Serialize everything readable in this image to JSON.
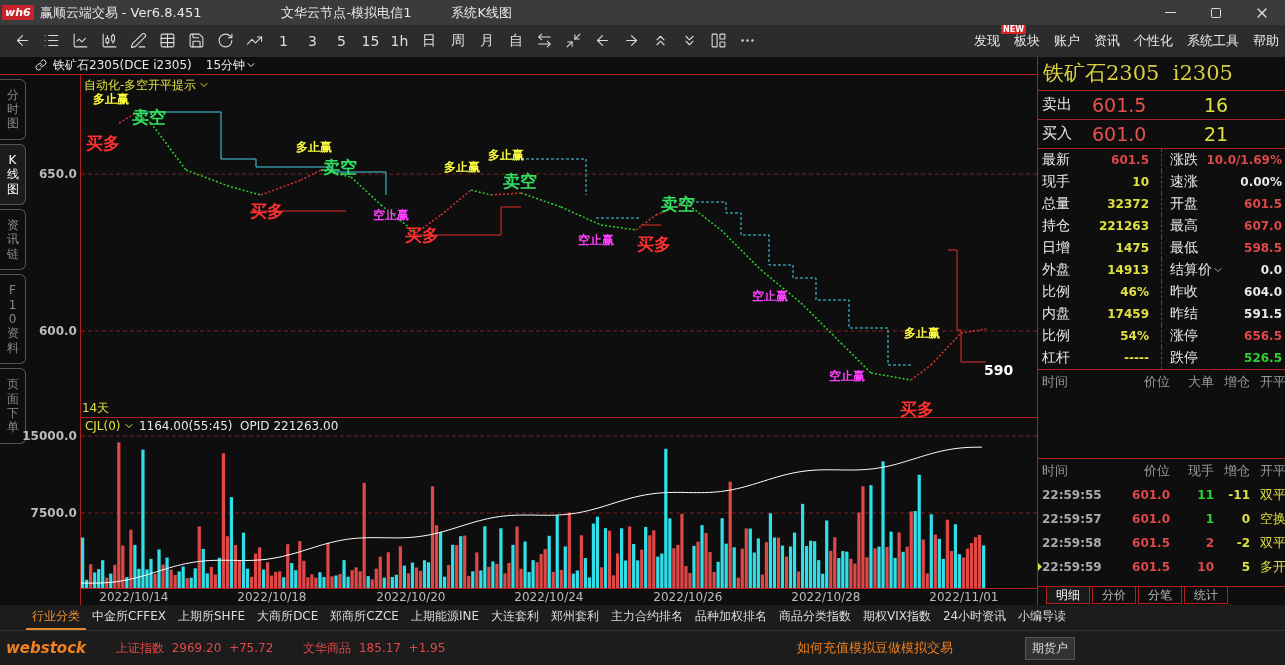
{
  "window": {
    "logo": "wh6",
    "title": "赢顺云端交易 - Ver6.8.451",
    "node": "文华云节点-模拟电信1",
    "view": "系统K线图"
  },
  "toolbar": {
    "periods": [
      "1",
      "3",
      "5",
      "15",
      "1h",
      "日",
      "周",
      "月",
      "自"
    ],
    "menu": [
      {
        "label": "发现",
        "badge": "NEW"
      },
      {
        "label": "板块"
      },
      {
        "label": "账户"
      },
      {
        "label": "资讯"
      },
      {
        "label": "个性化"
      },
      {
        "label": "系统工具"
      },
      {
        "label": "帮助"
      }
    ]
  },
  "chart_header": {
    "symbol": "铁矿石2305(DCE i2305)",
    "period": "15分钟"
  },
  "side_tabs": [
    {
      "label": "分时图",
      "selected": false
    },
    {
      "label": "K线图",
      "selected": true
    },
    {
      "label": "资讯链",
      "selected": false
    },
    {
      "label": "F10资料",
      "selected": false
    },
    {
      "label": "页面下单",
      "selected": false
    }
  ],
  "price_panel": {
    "indicator": "自动化-多空开平提示",
    "yticks": [
      "650.0",
      "600.0"
    ],
    "days": "14天",
    "last_label": "590",
    "signals": [
      {
        "text": "多止赢",
        "kind": "exit-long"
      },
      {
        "text": "卖空",
        "kind": "sell"
      },
      {
        "text": "买多",
        "kind": "buy"
      },
      {
        "text": "多止赢",
        "kind": "exit-long"
      },
      {
        "text": "卖空",
        "kind": "sell"
      },
      {
        "text": "买多",
        "kind": "buy"
      },
      {
        "text": "空止赢",
        "kind": "exit-short"
      },
      {
        "text": "买多",
        "kind": "buy"
      },
      {
        "text": "多止赢",
        "kind": "exit-long"
      },
      {
        "text": "多止赢",
        "kind": "exit-long"
      },
      {
        "text": "卖空",
        "kind": "sell"
      },
      {
        "text": "空止赢",
        "kind": "exit-short"
      },
      {
        "text": "买多",
        "kind": "buy"
      },
      {
        "text": "卖空",
        "kind": "sell"
      },
      {
        "text": "空止赢",
        "kind": "exit-short"
      },
      {
        "text": "空止赢",
        "kind": "exit-short"
      },
      {
        "text": "多止赢",
        "kind": "exit-long"
      },
      {
        "text": "买多",
        "kind": "buy"
      }
    ]
  },
  "volume_panel": {
    "indicator": "CJL(0)",
    "reading": "1164.00(55:45)  OPID 221263.00",
    "yticks": [
      "15000.0",
      "7500.0"
    ]
  },
  "dates": [
    "2022/10/14",
    "2022/10/18",
    "2022/10/20",
    "2022/10/24",
    "2022/10/26",
    "2022/10/28",
    "2022/11/01"
  ],
  "quote": {
    "title": "铁矿石2305  i2305",
    "book": [
      {
        "label": "卖出",
        "price": "601.5",
        "qty": "16"
      },
      {
        "label": "买入",
        "price": "601.0",
        "qty": "21"
      }
    ],
    "stats": [
      {
        "label": "最新",
        "value": "601.5",
        "color": "#e04848"
      },
      {
        "label": "涨跌",
        "value": "10.0/1.69%",
        "color": "#e04848"
      },
      {
        "label": "现手",
        "value": "10",
        "color": "#e0e040"
      },
      {
        "label": "速涨",
        "value": "0.00%",
        "color": "#e8e8e8"
      },
      {
        "label": "总量",
        "value": "32372",
        "color": "#e0e040"
      },
      {
        "label": "开盘",
        "value": "601.5",
        "color": "#e04848"
      },
      {
        "label": "持仓",
        "value": "221263",
        "color": "#e0e040"
      },
      {
        "label": "最高",
        "value": "607.0",
        "color": "#e04848"
      },
      {
        "label": "日增",
        "value": "1475",
        "color": "#e0e040"
      },
      {
        "label": "最低",
        "value": "598.5",
        "color": "#e04848"
      },
      {
        "label": "外盘",
        "value": "14913",
        "color": "#e0e040"
      },
      {
        "label": "结算价",
        "value": "0.0",
        "color": "#e8e8e8",
        "dropdown": true
      },
      {
        "label": "比例",
        "value": "46%",
        "color": "#e0e040"
      },
      {
        "label": "昨收",
        "value": "604.0",
        "color": "#e8e8e8"
      },
      {
        "label": "内盘",
        "value": "17459",
        "color": "#e0e040"
      },
      {
        "label": "昨结",
        "value": "591.5",
        "color": "#e8e8e8"
      },
      {
        "label": "比例",
        "value": "54%",
        "color": "#e0e040"
      },
      {
        "label": "涨停",
        "value": "656.5",
        "color": "#e04848"
      },
      {
        "label": "杠杆",
        "value": "-----",
        "color": "#e0e040"
      },
      {
        "label": "跌停",
        "value": "526.5",
        "color": "#30d030"
      }
    ],
    "big_orders_columns": [
      "时间",
      "价位",
      "大单",
      "增仓",
      "开平"
    ],
    "ticks_columns": [
      "时间",
      "价位",
      "现手",
      "增仓",
      "开平"
    ],
    "ticks": [
      {
        "time": "22:59:55",
        "price": "601.0",
        "qty": "11",
        "color": "#30d030",
        "change": "-11",
        "type": "双平",
        "selected": false
      },
      {
        "time": "22:59:57",
        "price": "601.0",
        "qty": "1",
        "color": "#30d030",
        "change": "0",
        "type": "空换",
        "selected": false
      },
      {
        "time": "22:59:58",
        "price": "601.5",
        "qty": "2",
        "color": "#e04848",
        "change": "-2",
        "type": "双平",
        "selected": false
      },
      {
        "time": "22:59:59",
        "price": "601.5",
        "qty": "10",
        "color": "#e04848",
        "change": "5",
        "type": "多开",
        "selected": true
      }
    ],
    "tabs": [
      {
        "label": "明细",
        "selected": true
      },
      {
        "label": "分价",
        "selected": false
      },
      {
        "label": "分笔",
        "selected": false
      },
      {
        "label": "统计",
        "selected": false
      }
    ]
  },
  "market_tabs": [
    {
      "label": "行业分类",
      "selected": true
    },
    {
      "label": "中金所CFFEX",
      "selected": false
    },
    {
      "label": "上期所SHFE",
      "selected": false
    },
    {
      "label": "大商所DCE",
      "selected": false
    },
    {
      "label": "郑商所CZCE",
      "selected": false
    },
    {
      "label": "上期能源INE",
      "selected": false
    },
    {
      "label": "大连套利",
      "selected": false
    },
    {
      "label": "郑州套利",
      "selected": false
    },
    {
      "label": "主力合约排名",
      "selected": false
    },
    {
      "label": "品种加权排名",
      "selected": false
    },
    {
      "label": "商品分类指数",
      "selected": false
    },
    {
      "label": "期权VIX指数",
      "selected": false
    },
    {
      "label": "24小时资讯",
      "selected": false
    },
    {
      "label": "小编导读",
      "selected": false
    }
  ],
  "status_bar": {
    "brand": "webstock",
    "indices": [
      {
        "name": "上证指数",
        "value": "2969.20",
        "change": "+75.72"
      },
      {
        "name": "文华商品",
        "value": "185.17",
        "change": "+1.95"
      }
    ],
    "notice": "如何充值模拟豆做模拟交易",
    "account_button": "期货户"
  }
}
